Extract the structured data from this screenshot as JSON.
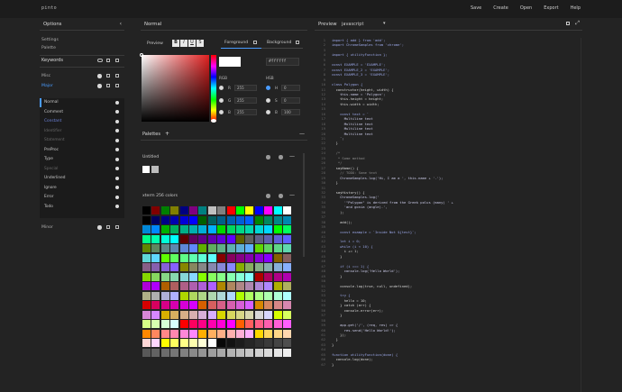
{
  "app": {
    "title": "pinto"
  },
  "topnav": [
    "Save",
    "Create",
    "Open",
    "Export",
    "Help"
  ],
  "options": {
    "title": "Options",
    "settings": "Settings",
    "palette": "Palette",
    "keywords": "Keywords",
    "misc": "Misc",
    "major": "Major",
    "minor": "Minor"
  },
  "keywords": [
    "Normal",
    "Comment",
    "Constant",
    "Identifier",
    "Statement",
    "PreProc",
    "Type",
    "Special",
    "Underlined",
    "Ignore",
    "Error",
    "Todo"
  ],
  "normal": {
    "title": "Normal",
    "preview": "Preview",
    "b": "B",
    "i": "I",
    "u": "U",
    "s": "S",
    "foreground": "Foreground",
    "background": "Background",
    "hex": "#ffffff",
    "rgb": "RGB",
    "hsb": "HSB",
    "r": "R",
    "g": "G",
    "bl": "B",
    "h": "H",
    "s2": "S",
    "b2": "B",
    "rv": "255",
    "gv": "255",
    "bv": "255",
    "hv": "0",
    "sv": "0",
    "bv2": "100"
  },
  "palettes": {
    "title": "Palettes",
    "plus": "+",
    "untitled": "Untitled",
    "xterm": "xterm 256 colors"
  },
  "preview": {
    "title": "Preview",
    "lang": "javascript"
  },
  "colors": {
    "accent": "#4a9cff",
    "keyword": "#5a6ab8",
    "string": "#a56ad8",
    "fn": "#9aa0d8",
    "bg": "#232323"
  },
  "code": [
    "import { add } from 'add';",
    "import ChromeSamples from 'chrome';",
    "",
    "import { utilityFunction };",
    "",
    "const EXAMPLE = 'EXAMPLE';",
    "const EXAMPLE_2 = 'EXAMPLE';",
    "const EXAMPLE_3 = 'EXAMPLE';",
    "",
    "class Polygon {",
    "  constructor(height, width) {",
    "    this.name = 'Polygon';",
    "    this.height = height;",
    "    this.width = width;",
    "",
    "    const text = `",
    "      Multiline text",
    "      Multiline text",
    "      Multiline text",
    "      Multiline text",
    "    `;",
    "  }",
    "",
    "  /*",
    "   * Some method",
    "   */",
    "  sayName() {",
    "    // TODO: Some text",
    "    ChromeSamples.log('Hi, I am a ', this.name + '.');",
    "  }",
    "",
    "  sayHistory() {",
    "    ChromeSamples.log('",
    "      '\"Polygon\" is derived from the Greek polus (many) ' +",
    "      'and gonia (angle).',",
    "    );",
    "",
    "    add();",
    "",
    "    const example = `Inside Not ${test}`;",
    "",
    "    let i = 0;",
    "    while (i < 10) {",
    "      i += 1;",
    "    }",
    "",
    "    if (i === 1) {",
    "      console.log('Hello World');",
    "    }",
    "",
    "    console.log(true, null, undefined);",
    "",
    "    try {",
    "      hello = 10;",
    "    } catch (err) {",
    "      console.error(err);",
    "    }",
    "",
    "    app.get('/', (req, res) => {",
    "      res.send('Hello World!');",
    "    });",
    "  }",
    "}",
    "",
    "function utilityFunction(done) {",
    "  console.log(done);",
    "}"
  ]
}
